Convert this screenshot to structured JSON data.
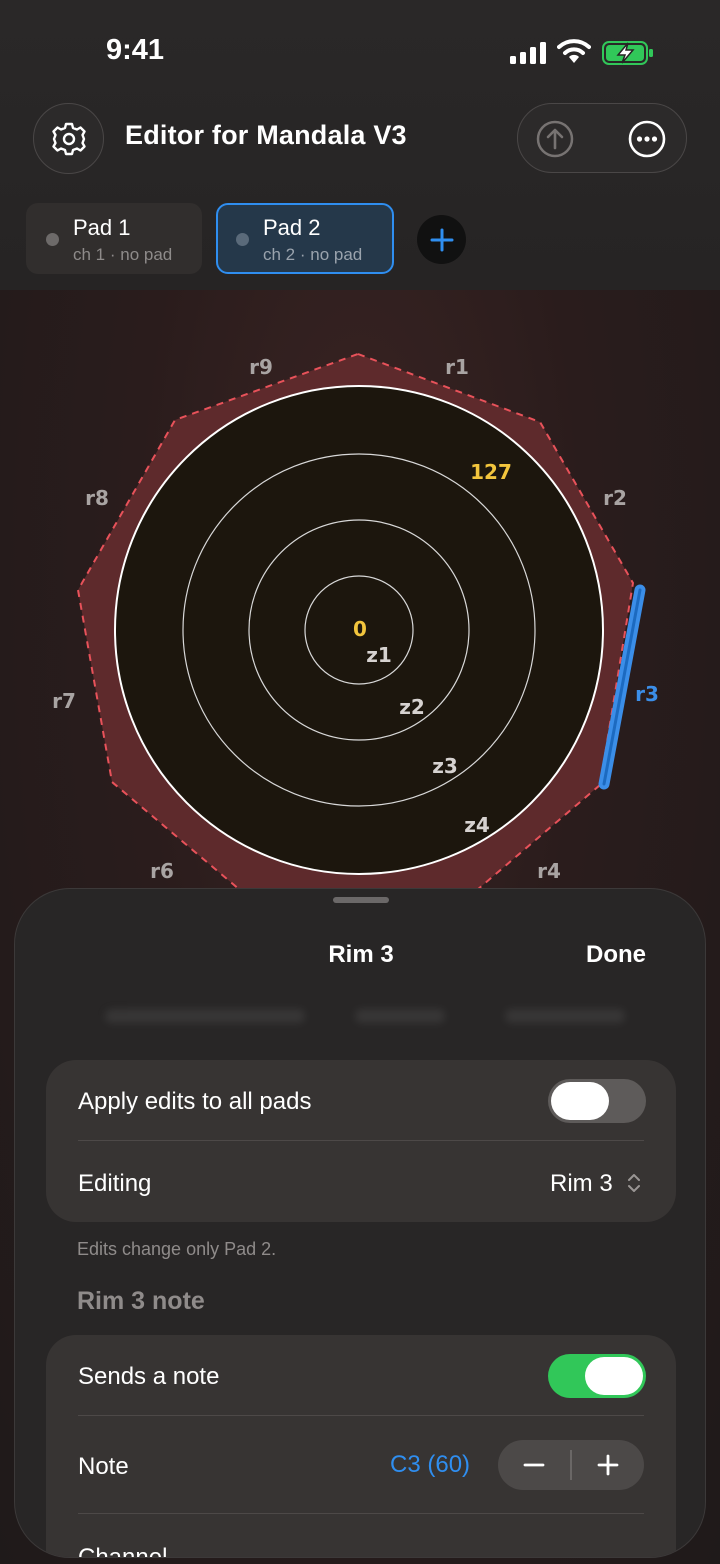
{
  "status_bar": {
    "time": "9:41"
  },
  "header": {
    "title": "Editor for Mandala V3"
  },
  "pads": [
    {
      "name": "Pad 1",
      "sub": "ch 1 · no pad",
      "selected": false
    },
    {
      "name": "Pad 2",
      "sub": "ch 2 · no pad",
      "selected": true
    }
  ],
  "drum": {
    "rim_labels": [
      "r1",
      "r2",
      "r3",
      "r4",
      "r6",
      "r7",
      "r8",
      "r9"
    ],
    "selected_rim": "r3",
    "zone_labels": [
      "z1",
      "z2",
      "z3",
      "z4"
    ],
    "velocity_min": "0",
    "velocity_max": "127"
  },
  "sheet": {
    "title": "Rim 3",
    "done_label": "Done",
    "apply_all_label": "Apply edits to all pads",
    "apply_all_on": false,
    "editing_label": "Editing",
    "editing_value": "Rim 3",
    "footnote": "Edits change only Pad 2.",
    "section_title": "Rim 3 note",
    "sends_note_label": "Sends a note",
    "sends_note_on": true,
    "note_label": "Note",
    "note_value": "C3 (60)",
    "channel_label": "Channel"
  },
  "colors": {
    "accent": "#2f8ef0",
    "toggle_on": "#31c759",
    "velocity_label": "#f2c53d",
    "rim_fill": "#5e2a2c",
    "rim_dash": "#e8525a"
  }
}
